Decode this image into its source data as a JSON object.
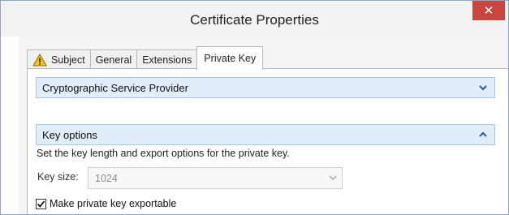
{
  "window": {
    "title": "Certificate Properties",
    "close_glyph": "✕"
  },
  "tabs": [
    {
      "label": "Subject",
      "icon": "warning-icon"
    },
    {
      "label": "General"
    },
    {
      "label": "Extensions"
    },
    {
      "label": "Private Key",
      "active": true
    }
  ],
  "sections": {
    "csp": {
      "label": "Cryptographic Service Provider",
      "state": "collapsed"
    },
    "key_options": {
      "label": "Key options",
      "state": "expanded",
      "description": "Set the key length and export options for the private key.",
      "key_size_label": "Key size:",
      "key_size_value": "1024",
      "exportable_label": "Make private key exportable",
      "exportable_checked": true
    }
  },
  "colors": {
    "close_button": "#c94640",
    "section_header_bg": "#e1eef9",
    "chevron": "#2d5fa8"
  }
}
